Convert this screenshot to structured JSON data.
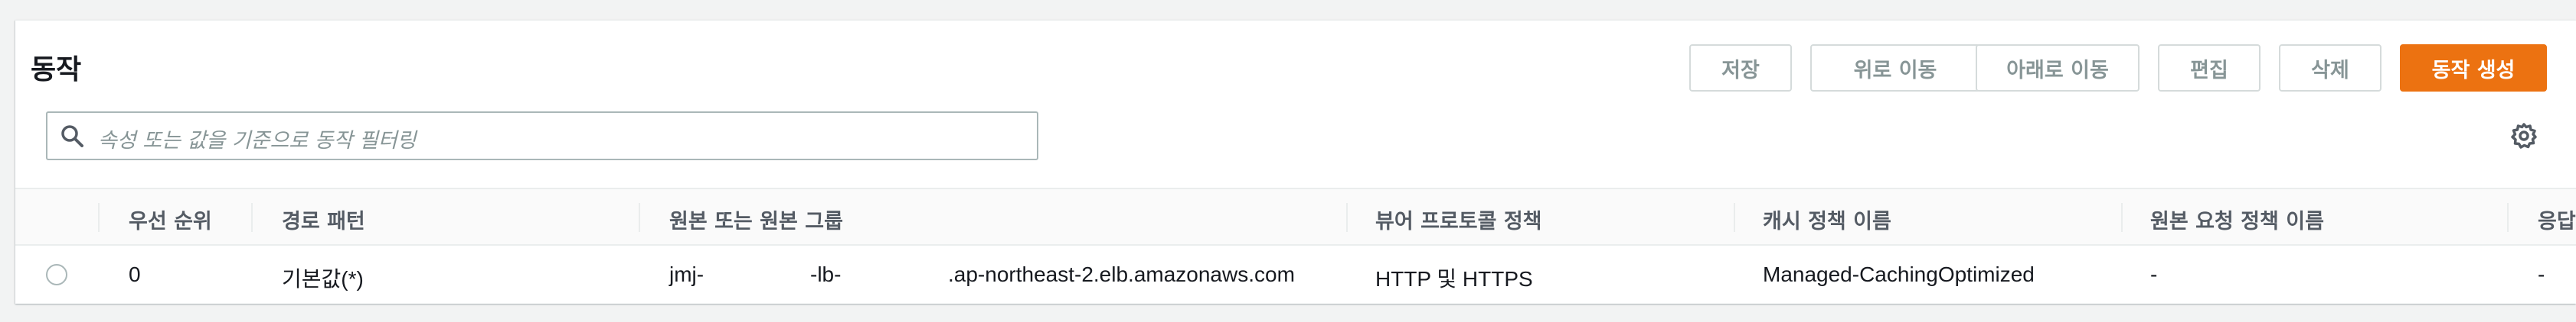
{
  "section": {
    "title": "동작"
  },
  "toolbar": {
    "save_label": "저장",
    "move_up_label": "위로 이동",
    "move_down_label": "아래로 이동",
    "edit_label": "편집",
    "delete_label": "삭제",
    "create_label": "동작 생성",
    "primary_color": "#ec7211"
  },
  "search": {
    "placeholder": "속성 또는 값을 기준으로 동작 필터링",
    "icon": "search-icon"
  },
  "settings": {
    "icon": "gear-icon"
  },
  "table": {
    "columns": [
      "우선 순위",
      "경로 패턴",
      "원본 또는 원본 그룹",
      "뷰어 프로토콜 정책",
      "캐시 정책 이름",
      "원본 요청 정책 이름",
      "응답"
    ],
    "rows": [
      {
        "selected": false,
        "priority": "0",
        "path_pattern": "기본값(*)",
        "origin_part1": "jmj-",
        "origin_part2": "-lb-",
        "origin_part3": ".ap-northeast-2.elb.amazonaws.com",
        "viewer_protocol": "HTTP 및 HTTPS",
        "cache_policy": "Managed-CachingOptimized",
        "origin_request_policy": "-",
        "response": "-"
      }
    ]
  }
}
